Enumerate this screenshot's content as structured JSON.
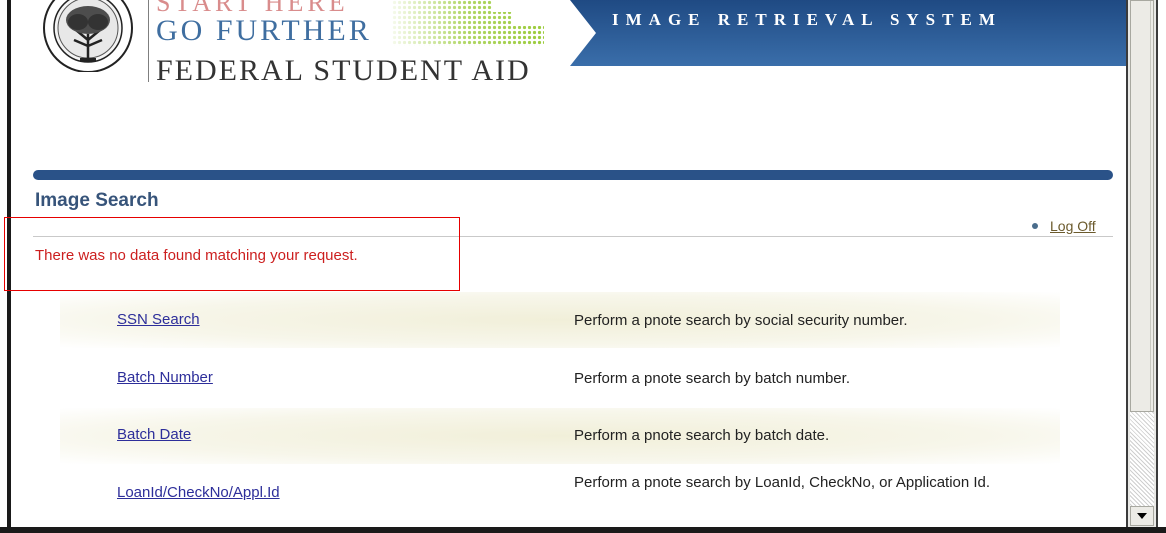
{
  "header": {
    "tagline_top": "START HERE",
    "tagline_main": "GO FURTHER",
    "org_name": "FEDERAL STUDENT AID",
    "system_title": "IMAGE RETRIEVAL SYSTEM"
  },
  "page": {
    "title": "Image Search",
    "logoff_label": "Log Off",
    "error_message": "There was no data found matching your request."
  },
  "search_options": [
    {
      "link": "SSN Search",
      "description": "Perform a pnote search by social security number."
    },
    {
      "link": "Batch Number",
      "description": "Perform a pnote search by batch number."
    },
    {
      "link": "Batch Date",
      "description": "Perform a pnote search by batch date."
    },
    {
      "link": "LoanId/CheckNo/Appl.Id",
      "description": "Perform a pnote search by LoanId, CheckNo, or Application Id."
    }
  ],
  "colors": {
    "banner_blue": "#2a5288",
    "title_blue": "#37547a",
    "error_red": "#cc1f1f",
    "link_blue": "#2d2e9a",
    "highlight_box": "#e60000"
  }
}
